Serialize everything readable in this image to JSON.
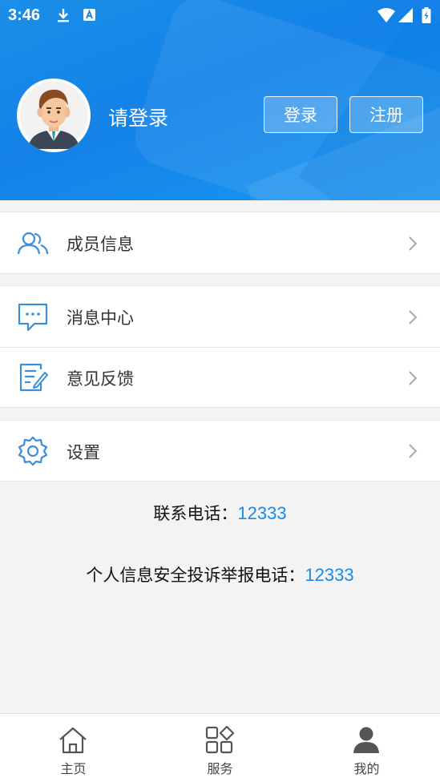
{
  "status_bar": {
    "time": "3:46",
    "icons": [
      "download-icon",
      "a-badge-icon",
      "wifi-icon",
      "signal-icon",
      "battery-icon"
    ]
  },
  "profile": {
    "login_prompt": "请登录",
    "login_button": "登录",
    "register_button": "注册"
  },
  "menu": {
    "members": "成员信息",
    "messages": "消息中心",
    "feedback": "意见反馈",
    "settings": "设置"
  },
  "contact": {
    "phone_label": "联系电话：",
    "phone_number": "12333",
    "report_label": "个人信息安全投诉举报电话：",
    "report_number": "12333"
  },
  "tabs": {
    "home": "主页",
    "service": "服务",
    "mine": "我的"
  },
  "colors": {
    "accent": "#1a8ae8",
    "header_blue": "#1482e8",
    "icon_blue": "#3a8fd8"
  }
}
